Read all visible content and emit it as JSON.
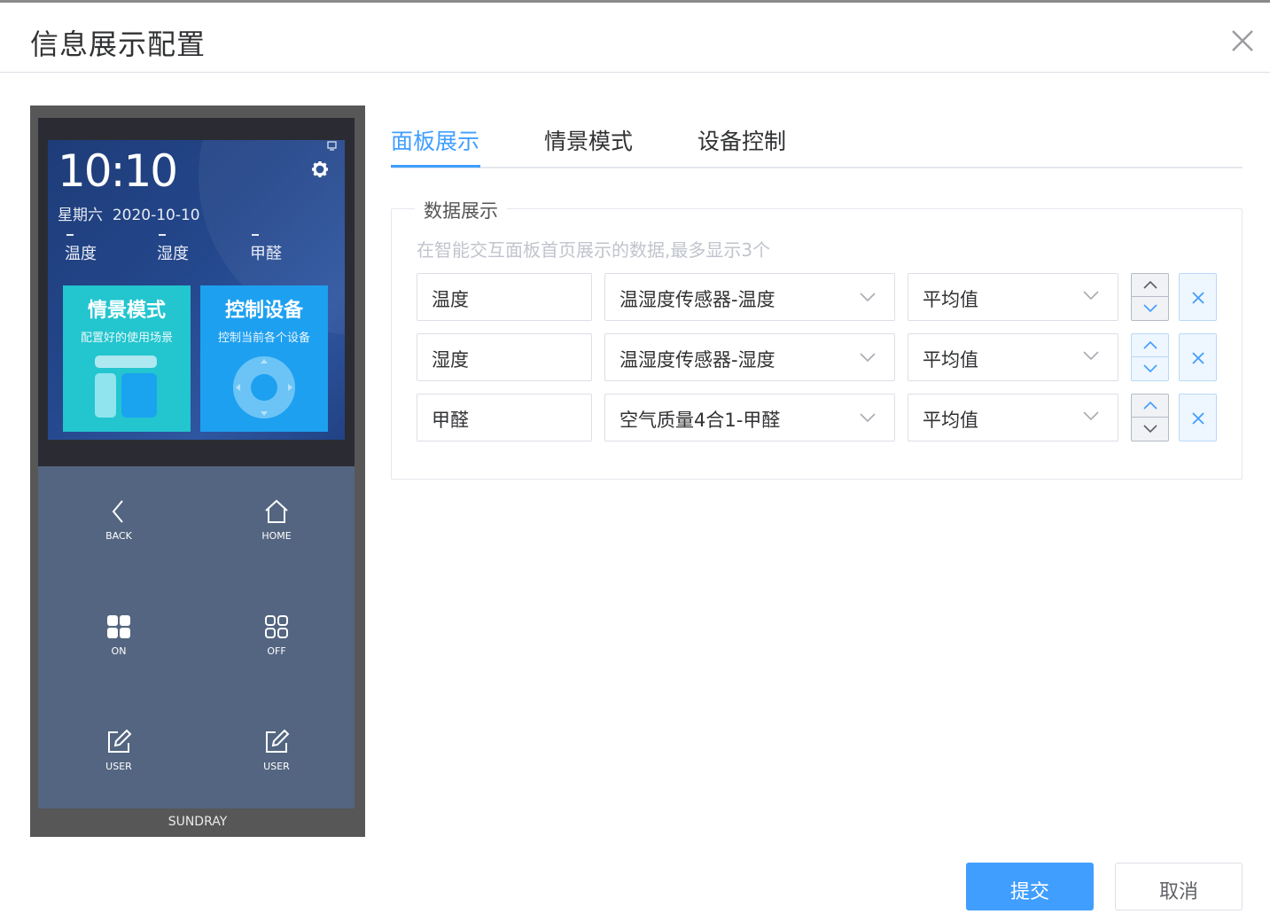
{
  "dialog": {
    "title": "信息展示配置"
  },
  "preview": {
    "time": "10:10",
    "weekday": "星期六",
    "date": "2020-10-10",
    "metrics": [
      "温度",
      "湿度",
      "甲醛"
    ],
    "tiles": [
      {
        "title": "情景模式",
        "subtitle": "配置好的使用场景"
      },
      {
        "title": "控制设备",
        "subtitle": "控制当前各个设备"
      }
    ],
    "keys": [
      {
        "label": "BACK",
        "icon": "back-chevron-icon"
      },
      {
        "label": "HOME",
        "icon": "home-icon"
      },
      {
        "label": "ON",
        "icon": "grid-filled-icon"
      },
      {
        "label": "OFF",
        "icon": "grid-outline-icon"
      },
      {
        "label": "USER",
        "icon": "edit-icon"
      },
      {
        "label": "USER",
        "icon": "edit-icon"
      }
    ],
    "brand": "SUNDRAY"
  },
  "tabs": [
    {
      "label": "面板展示",
      "active": true
    },
    {
      "label": "情景模式",
      "active": false
    },
    {
      "label": "设备控制",
      "active": false
    }
  ],
  "data_display": {
    "legend": "数据展示",
    "hint": "在智能交互面板首页展示的数据,最多显示3个",
    "rows": [
      {
        "name": "温度",
        "source": "温湿度传感器-温度",
        "aggregate": "平均值"
      },
      {
        "name": "湿度",
        "source": "温湿度传感器-湿度",
        "aggregate": "平均值"
      },
      {
        "name": "甲醛",
        "source": "空气质量4合1-甲醛",
        "aggregate": "平均值"
      }
    ]
  },
  "footer": {
    "submit_label": "提交",
    "cancel_label": "取消"
  },
  "colors": {
    "accent": "#409eff",
    "tile_scene": "#23c5cf",
    "tile_control": "#1ea0f0",
    "keypad": "#536580"
  }
}
